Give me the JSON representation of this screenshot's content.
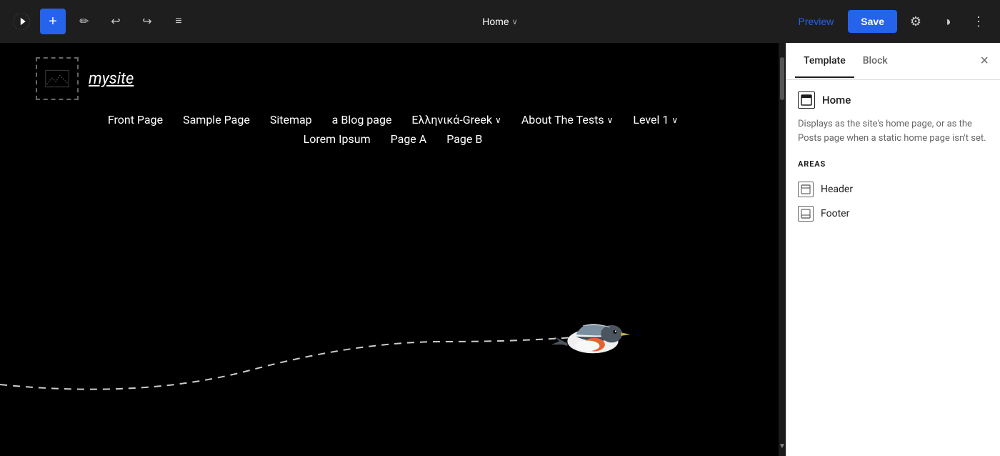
{
  "toolbar": {
    "add_label": "+",
    "edit_label": "✏",
    "undo_label": "↩",
    "redo_label": "↪",
    "list_label": "≡",
    "page_title": "Home",
    "chevron": "∨",
    "preview_label": "Preview",
    "save_label": "Save",
    "settings_icon": "⚙",
    "contrast_icon": "◑",
    "more_icon": "⋮"
  },
  "canvas": {
    "site_name": "mysite",
    "nav_items": [
      {
        "label": "Front Page",
        "has_dropdown": false
      },
      {
        "label": "Sample Page",
        "has_dropdown": false
      },
      {
        "label": "Sitemap",
        "has_dropdown": false
      },
      {
        "label": "a Blog page",
        "has_dropdown": false
      },
      {
        "label": "Ελληνικά-Greek",
        "has_dropdown": true
      },
      {
        "label": "About The Tests",
        "has_dropdown": true
      },
      {
        "label": "Level 1",
        "has_dropdown": true
      }
    ],
    "sub_nav_items": [
      {
        "label": "Lorem Ipsum"
      },
      {
        "label": "Page A"
      },
      {
        "label": "Page B"
      }
    ]
  },
  "panel": {
    "tab_template": "Template",
    "tab_block": "Block",
    "close_label": "×",
    "home_label": "Home",
    "home_desc": "Displays as the site's home page, or as the Posts page when a static home page isn't set.",
    "areas_label": "AREAS",
    "areas": [
      {
        "label": "Header",
        "icon_type": "header"
      },
      {
        "label": "Footer",
        "icon_type": "footer"
      }
    ]
  }
}
